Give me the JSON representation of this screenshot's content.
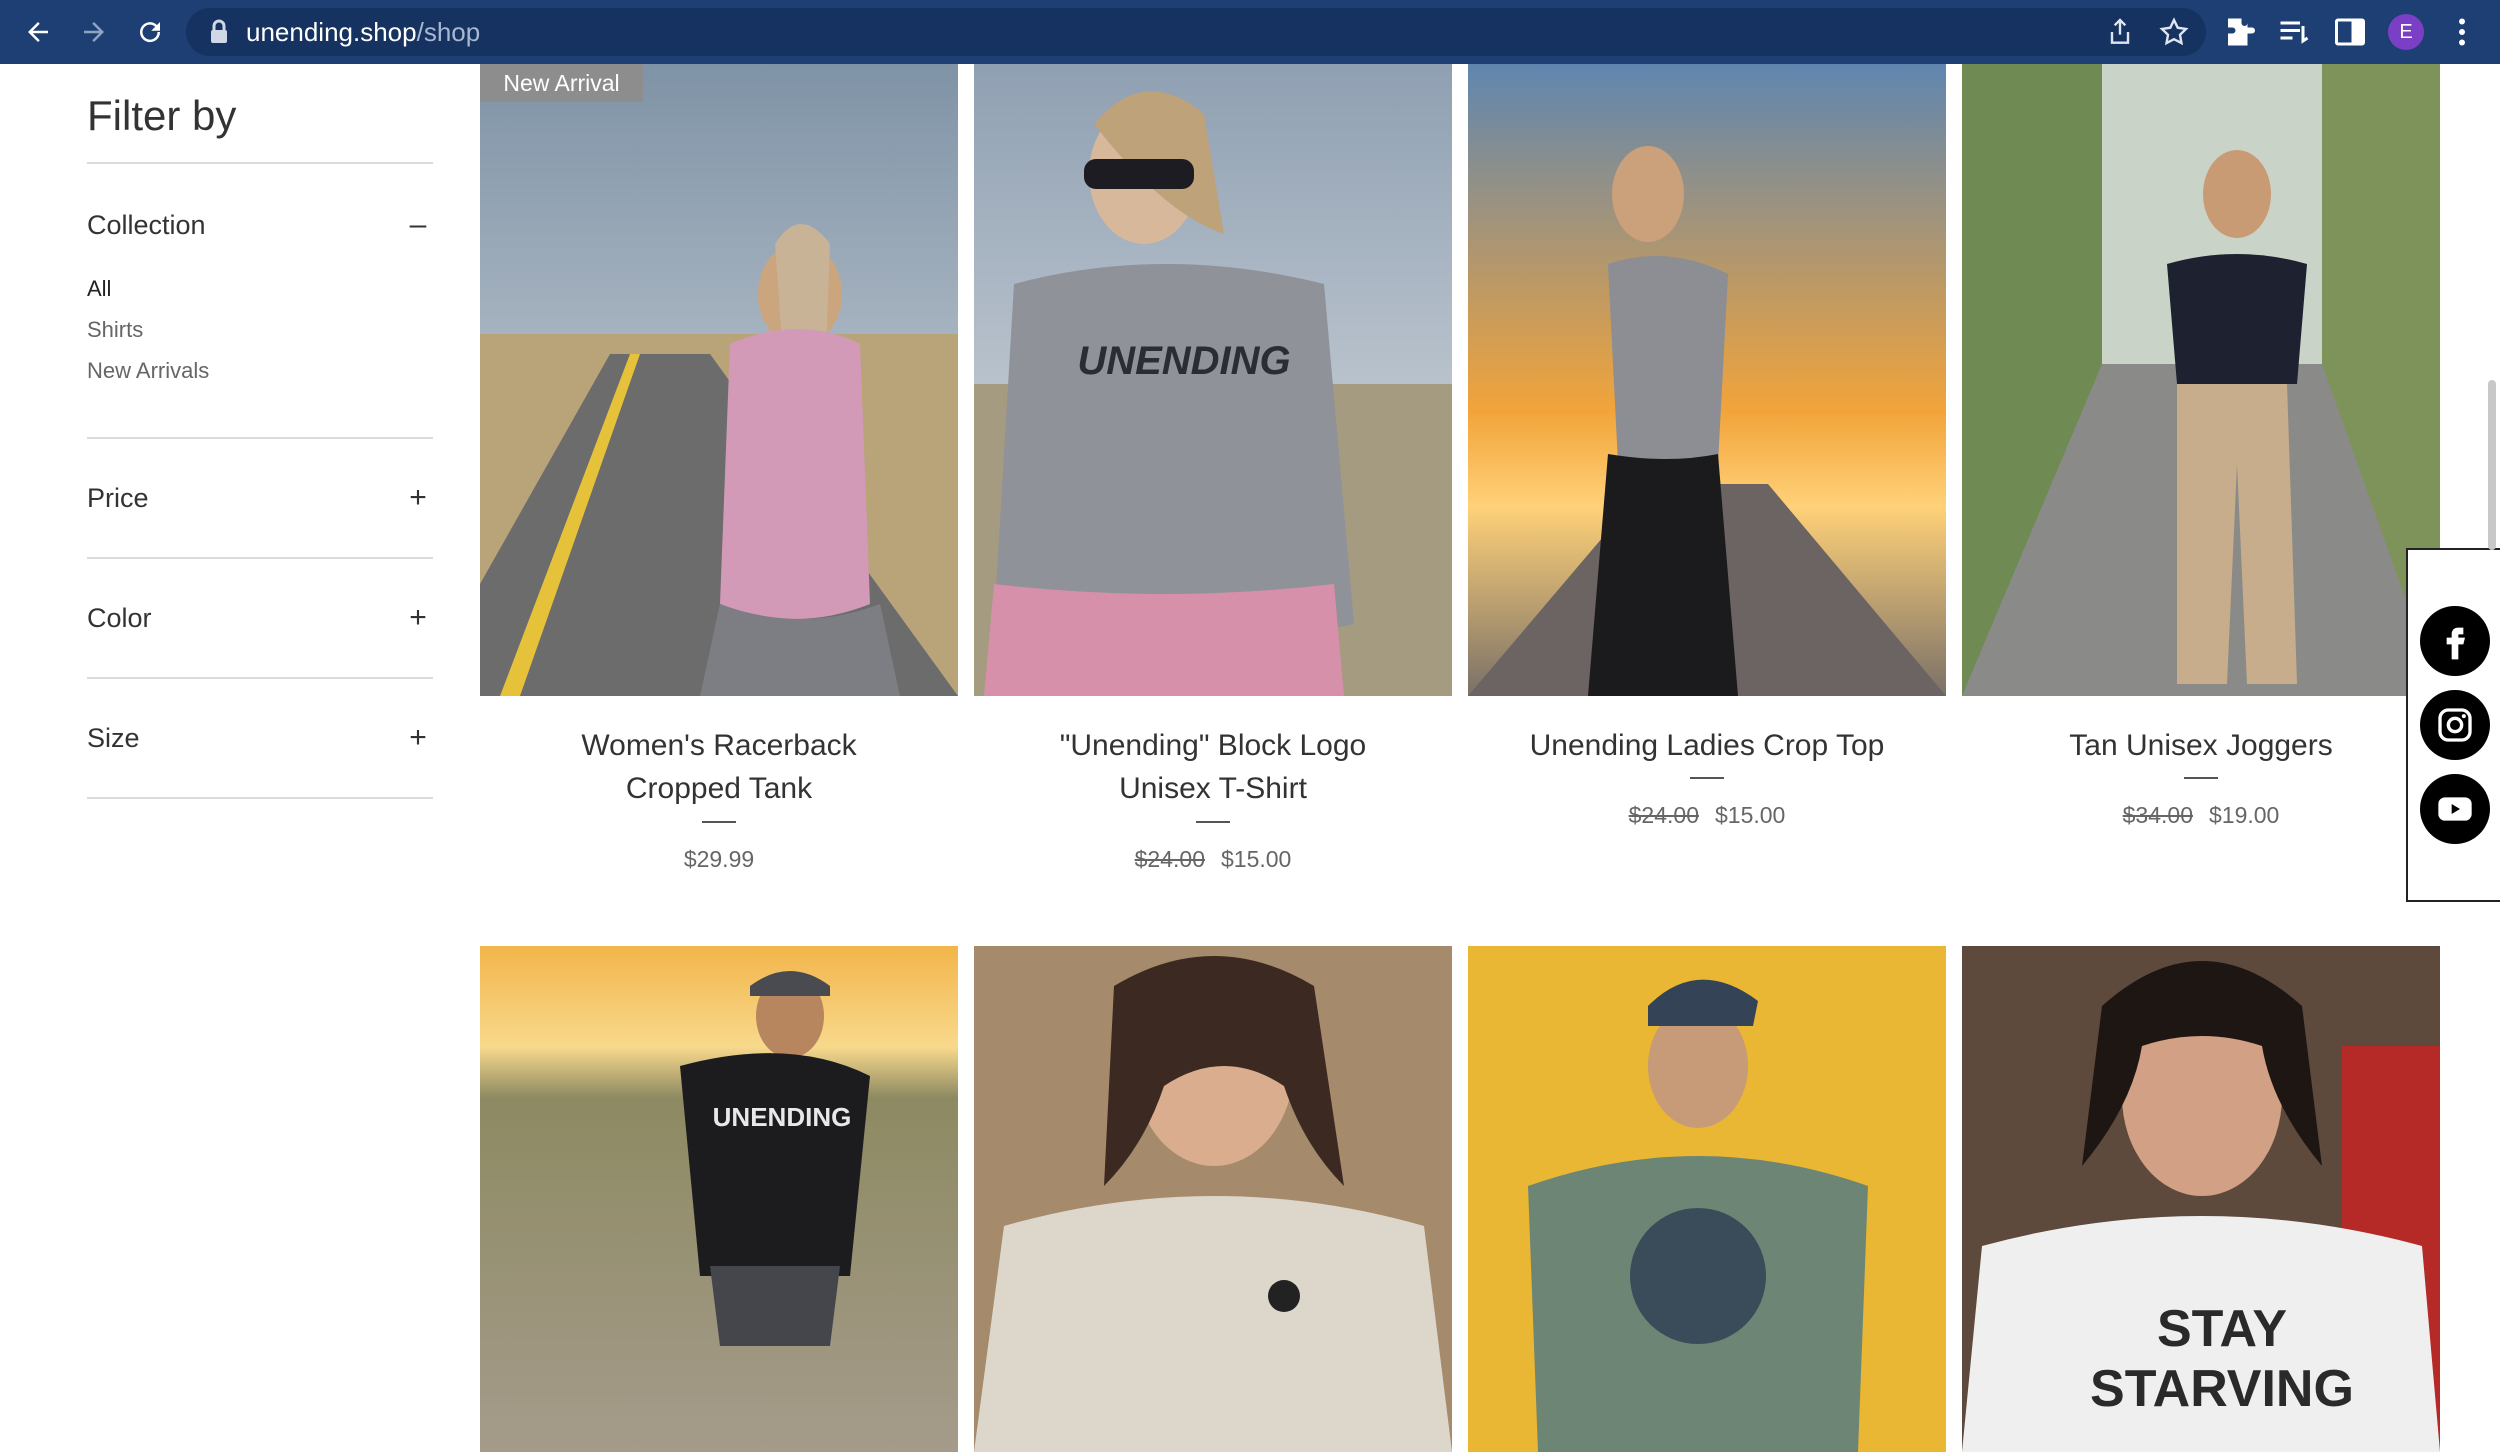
{
  "browser": {
    "url_host": "unending.shop",
    "url_path": "/shop",
    "profile_initial": "E"
  },
  "sidebar": {
    "title": "Filter by",
    "sections": [
      {
        "label": "Collection",
        "toggle": "–",
        "expanded": true
      },
      {
        "label": "Price",
        "toggle": "+",
        "expanded": false
      },
      {
        "label": "Color",
        "toggle": "+",
        "expanded": false
      },
      {
        "label": "Size",
        "toggle": "+",
        "expanded": false
      }
    ],
    "collection_items": [
      "All",
      "Shirts",
      "New Arrivals"
    ]
  },
  "badge": "New Arrival",
  "products": [
    {
      "name_line1": "Women's Racerback",
      "name_line2": "Cropped Tank",
      "old_price": "",
      "price": "$29.99"
    },
    {
      "name_line1": "\"Unending\" Block Logo",
      "name_line2": "Unisex T-Shirt",
      "old_price": "$24.00",
      "price": "$15.00"
    },
    {
      "name_line1": "Unending Ladies Crop Top",
      "name_line2": "",
      "old_price": "$24.00",
      "price": "$15.00"
    },
    {
      "name_line1": "Tan Unisex Joggers",
      "name_line2": "",
      "old_price": "$34.00",
      "price": "$19.00"
    }
  ],
  "image_text": {
    "tshirt_logo": "UNENDING",
    "hoodie_logo": "UNENDING",
    "stay": "STAY",
    "starving": "STARVING"
  },
  "colors": {
    "browser_bar": "#1d3f73",
    "badge": "#8d8d8d"
  },
  "social_icons": [
    "facebook-icon",
    "instagram-icon",
    "youtube-icon"
  ]
}
